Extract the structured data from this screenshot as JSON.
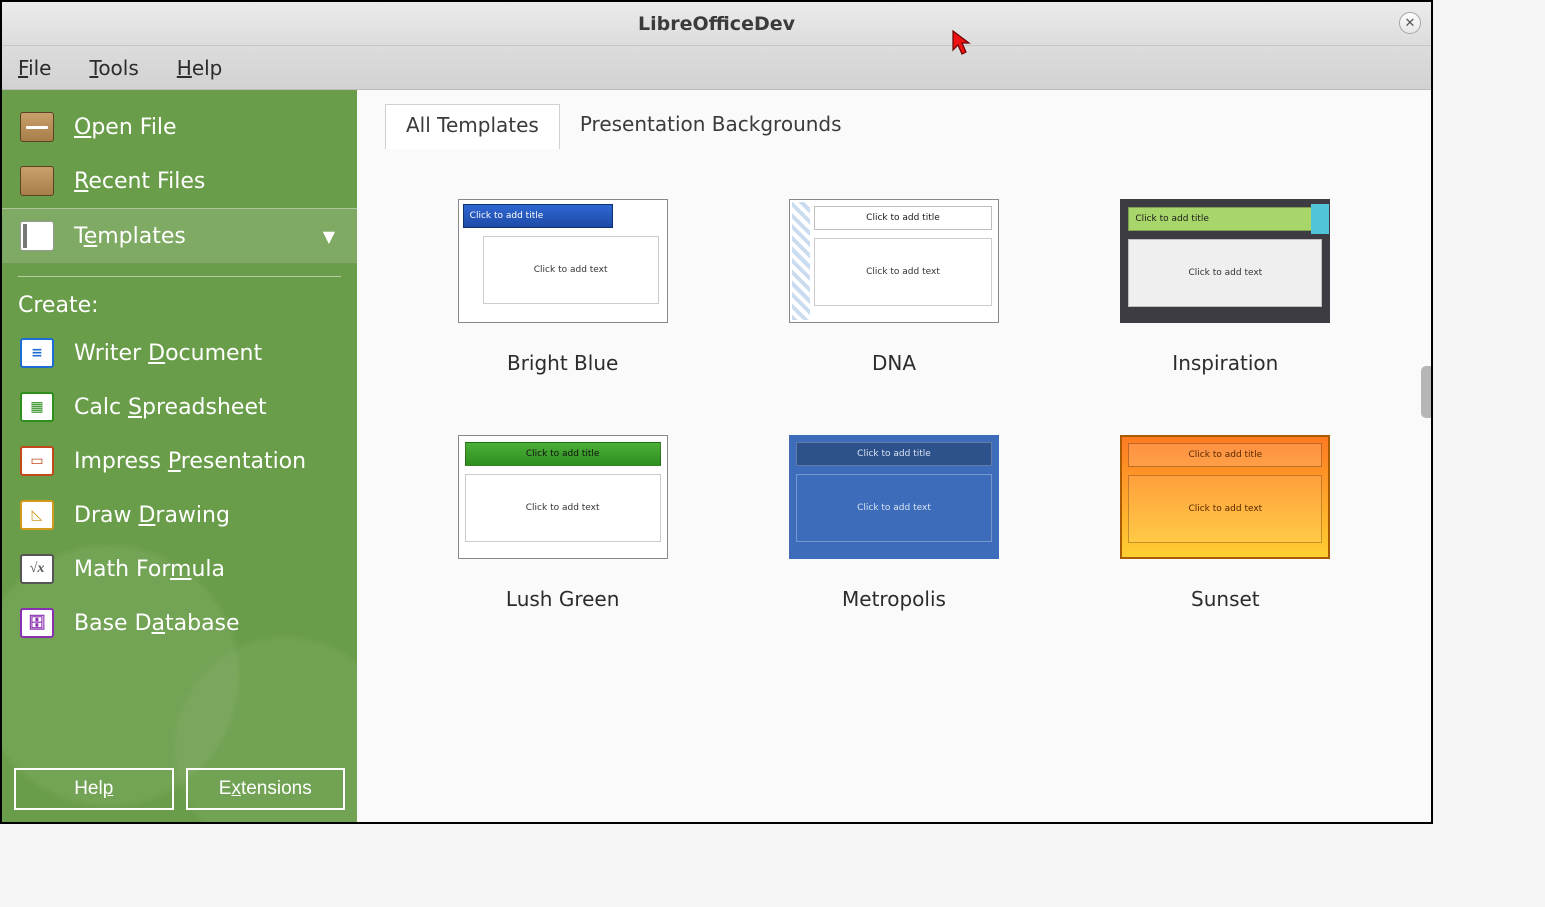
{
  "window": {
    "title": "LibreOfficeDev"
  },
  "menubar": [
    {
      "label": "File",
      "mn": "F"
    },
    {
      "label": "Tools",
      "mn": "T"
    },
    {
      "label": "Help",
      "mn": "H"
    }
  ],
  "sidebar": {
    "open_file": "Open File",
    "recent_files": "Recent Files",
    "templates": "Templates",
    "create_label": "Create:",
    "create_items": [
      {
        "label": "Writer Document",
        "mn": "D",
        "kind": "writer"
      },
      {
        "label": "Calc Spreadsheet",
        "mn": "S",
        "kind": "calc"
      },
      {
        "label": "Impress Presentation",
        "mn": "P",
        "kind": "impress"
      },
      {
        "label": "Draw Drawing",
        "mn": "D",
        "kind": "draw"
      },
      {
        "label": "Math Formula",
        "mn": "m",
        "kind": "math"
      },
      {
        "label": "Base Database",
        "mn": "a",
        "kind": "base"
      }
    ],
    "help_btn": "Help",
    "ext_btn": "Extensions"
  },
  "tabs": [
    {
      "label": "All Templates",
      "active": true
    },
    {
      "label": "Presentation Backgrounds",
      "active": false
    }
  ],
  "thumb_strings": {
    "title": "Click to add title",
    "body": "Click to add text"
  },
  "templates": [
    {
      "label": "Bright Blue",
      "cls": "brightblue"
    },
    {
      "label": "DNA",
      "cls": "dna"
    },
    {
      "label": "Inspiration",
      "cls": "inspiration"
    },
    {
      "label": "Lush Green",
      "cls": "lushgreen"
    },
    {
      "label": "Metropolis",
      "cls": "metropolis"
    },
    {
      "label": "Sunset",
      "cls": "sunset"
    }
  ]
}
